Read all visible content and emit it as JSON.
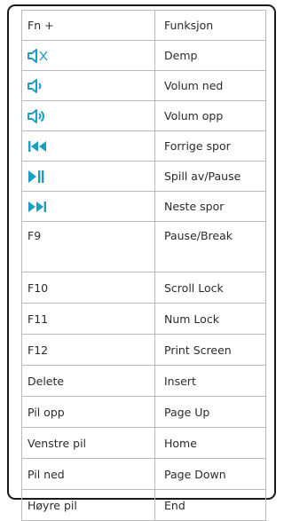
{
  "header": {
    "key": "Fn +",
    "function": "Funksjon"
  },
  "rows": [
    {
      "key_icon": "mute-icon",
      "function": "Demp"
    },
    {
      "key_icon": "volume-down-icon",
      "function": "Volum ned"
    },
    {
      "key_icon": "volume-up-icon",
      "function": "Volum opp"
    },
    {
      "key_icon": "previous-track-icon",
      "function": "Forrige spor"
    },
    {
      "key_icon": "play-pause-icon",
      "function": "Spill av/Pause"
    },
    {
      "key_icon": "next-track-icon",
      "function": "Neste spor"
    },
    {
      "key": "F9",
      "function": "Pause/Break"
    },
    {
      "key": "F10",
      "function": "Scroll Lock"
    },
    {
      "key": "F11",
      "function": "Num Lock"
    },
    {
      "key": "F12",
      "function": "Print Screen"
    },
    {
      "key": "Delete",
      "function": "Insert"
    },
    {
      "key": "Pil opp",
      "function": "Page Up"
    },
    {
      "key": "Venstre pil",
      "function": "Home"
    },
    {
      "key": "Pil ned",
      "function": "Page Down"
    },
    {
      "key": "Høyre pil",
      "function": "End"
    }
  ],
  "colors": {
    "icon": "#1a9ec5",
    "border": "#b9b9b9",
    "frame": "#1a1a1a"
  }
}
